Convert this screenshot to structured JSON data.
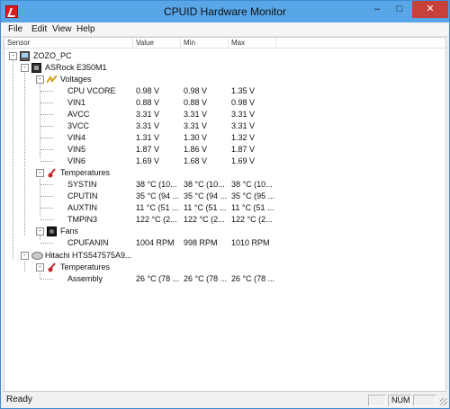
{
  "window": {
    "title": "CPUID Hardware Monitor",
    "close_glyph": "✕",
    "min_glyph": "–",
    "max_glyph": "□"
  },
  "menu": {
    "file": "File",
    "edit": "Edit",
    "view": "View",
    "help": "Help"
  },
  "columns": {
    "sensor": "Sensor",
    "value": "Value",
    "min": "Min",
    "max": "Max"
  },
  "tree": {
    "pc": "ZOZO_PC",
    "board": "ASRock E350M1",
    "voltages_group": "Voltages",
    "voltages": [
      {
        "name": "CPU VCORE",
        "value": "0.98 V",
        "min": "0.98 V",
        "max": "1.35 V"
      },
      {
        "name": "VIN1",
        "value": "0.88 V",
        "min": "0.88 V",
        "max": "0.98 V"
      },
      {
        "name": "AVCC",
        "value": "3.31 V",
        "min": "3.31 V",
        "max": "3.31 V"
      },
      {
        "name": "3VCC",
        "value": "3.31 V",
        "min": "3.31 V",
        "max": "3.31 V"
      },
      {
        "name": "VIN4",
        "value": "1.31 V",
        "min": "1.30 V",
        "max": "1.32 V"
      },
      {
        "name": "VIN5",
        "value": "1.87 V",
        "min": "1.86 V",
        "max": "1.87 V"
      },
      {
        "name": "VIN6",
        "value": "1.69 V",
        "min": "1.68 V",
        "max": "1.69 V"
      }
    ],
    "temps_group": "Temperatures",
    "temps": [
      {
        "name": "SYSTIN",
        "value": "38 °C (10...",
        "min": "38 °C (10...",
        "max": "38 °C (10..."
      },
      {
        "name": "CPUTIN",
        "value": "35 °C (94 ...",
        "min": "35 °C (94 ...",
        "max": "35 °C (95 ..."
      },
      {
        "name": "AUXTIN",
        "value": "11 °C (51 ...",
        "min": "11 °C (51 ...",
        "max": "11 °C (51 ..."
      },
      {
        "name": "TMPIN3",
        "value": "122 °C (2...",
        "min": "122 °C (2...",
        "max": "122 °C (2..."
      }
    ],
    "fans_group": "Fans",
    "fans": [
      {
        "name": "CPUFANIN",
        "value": "1004 RPM",
        "min": "998 RPM",
        "max": "1010 RPM"
      }
    ],
    "hdd": "Hitachi HTS547575A9...",
    "hdd_temps_group": "Temperatures",
    "hdd_temps": [
      {
        "name": "Assembly",
        "value": "26 °C (78 ...",
        "min": "26 °C (78 ...",
        "max": "26 °C (78 ..."
      }
    ]
  },
  "status": {
    "text": "Ready",
    "num": "NUM"
  },
  "icons": [
    "app-icon",
    "pc-icon",
    "motherboard-icon",
    "voltage-icon",
    "thermometer-icon",
    "fan-icon",
    "hard-drive-icon"
  ],
  "colors": {
    "titlebar": "#58a6e8",
    "close_button": "#c7403a",
    "app_icon": "#d81e1e"
  }
}
